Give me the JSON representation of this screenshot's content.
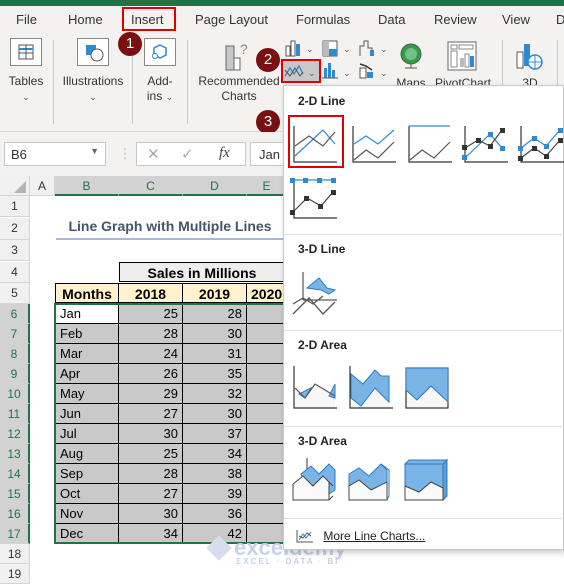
{
  "ribbon_tabs": [
    "File",
    "Home",
    "Insert",
    "Page Layout",
    "Formulas",
    "Data",
    "Review",
    "View",
    "D"
  ],
  "ribbon": {
    "tables": "Tables",
    "illustrations": "Illustrations",
    "addins_1": "Add-",
    "addins_2": "ins",
    "recommended_1": "Recommended",
    "recommended_2": "Charts",
    "maps": "Maps",
    "pivotchart": "PivotChart",
    "threed": "3D"
  },
  "steps": [
    "1",
    "2",
    "3"
  ],
  "formula_bar": {
    "name_box": "B6",
    "fx": "fx",
    "value": "Jan"
  },
  "columns": [
    "A",
    "B",
    "C",
    "D",
    "E"
  ],
  "rows": [
    "1",
    "2",
    "3",
    "4",
    "5",
    "6",
    "7",
    "8",
    "9",
    "10",
    "11",
    "12",
    "13",
    "14",
    "15",
    "16",
    "17",
    "18",
    "19"
  ],
  "sheet": {
    "title": "Line Graph with Multiple Lines",
    "group_header": "Sales in Millions",
    "headers": [
      "Months",
      "2018",
      "2019",
      "2020"
    ],
    "data": [
      [
        "Jan",
        "25",
        "28"
      ],
      [
        "Feb",
        "28",
        "30"
      ],
      [
        "Mar",
        "24",
        "31"
      ],
      [
        "Apr",
        "26",
        "35"
      ],
      [
        "May",
        "29",
        "32"
      ],
      [
        "Jun",
        "27",
        "30"
      ],
      [
        "Jul",
        "30",
        "37"
      ],
      [
        "Aug",
        "25",
        "34"
      ],
      [
        "Sep",
        "28",
        "38"
      ],
      [
        "Oct",
        "27",
        "39"
      ],
      [
        "Nov",
        "30",
        "36"
      ],
      [
        "Dec",
        "34",
        "42"
      ]
    ]
  },
  "dropdown": {
    "sections": [
      "2-D Line",
      "3-D Line",
      "2-D Area",
      "3-D Area"
    ],
    "more": "More Line Charts..."
  },
  "colors": {
    "accent": "#217346",
    "highlight": "#e00000",
    "badge": "#7a1010",
    "chart_blue": "#2e8bcf",
    "area_fill": "#85b8e6"
  },
  "watermark": {
    "brand": "exceldemy",
    "tagline": "EXCEL · DATA · BI"
  }
}
